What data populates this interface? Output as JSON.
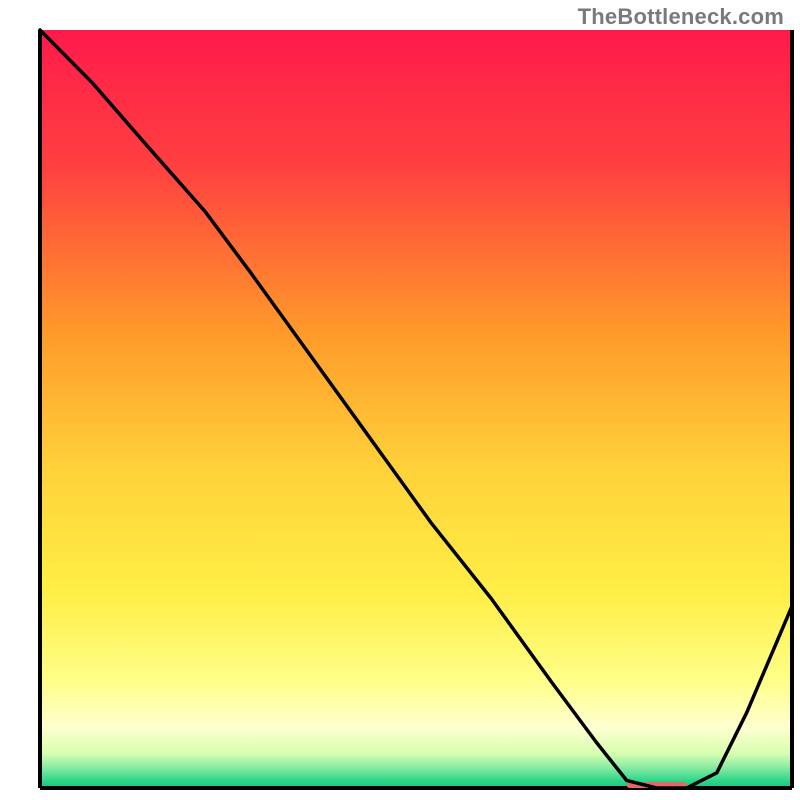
{
  "attribution": "TheBottleneck.com",
  "chart_data": {
    "type": "line",
    "title": "",
    "xlabel": "",
    "ylabel": "",
    "xlim": [
      0,
      100
    ],
    "ylim": [
      0,
      100
    ],
    "grid": false,
    "legend": false,
    "axes_visible": {
      "x_bottom": true,
      "y_left": true,
      "y_right": true,
      "x_top": false
    },
    "background_gradient": {
      "stops": [
        {
          "pos": 0.0,
          "color": "#ff1a4b"
        },
        {
          "pos": 0.18,
          "color": "#ff4040"
        },
        {
          "pos": 0.4,
          "color": "#ff9a2a"
        },
        {
          "pos": 0.58,
          "color": "#ffd23a"
        },
        {
          "pos": 0.74,
          "color": "#ffee45"
        },
        {
          "pos": 0.86,
          "color": "#ffff8a"
        },
        {
          "pos": 0.92,
          "color": "#ffffd0"
        },
        {
          "pos": 0.955,
          "color": "#d7ffb0"
        },
        {
          "pos": 0.975,
          "color": "#7fe8a0"
        },
        {
          "pos": 0.99,
          "color": "#2fd68a"
        },
        {
          "pos": 1.0,
          "color": "#1bc57a"
        }
      ]
    },
    "series": [
      {
        "name": "curve",
        "x": [
          0,
          7,
          14,
          22,
          28,
          36,
          44,
          52,
          60,
          68,
          74,
          78,
          82,
          86,
          90,
          94,
          100
        ],
        "y": [
          100,
          93,
          85,
          76,
          68,
          57,
          46,
          35,
          25,
          14,
          6,
          1,
          0,
          0,
          2,
          10,
          24
        ]
      }
    ],
    "flat_marker": {
      "x_start": 78,
      "x_end": 86,
      "y": 0,
      "color": "#e06a6a"
    }
  }
}
